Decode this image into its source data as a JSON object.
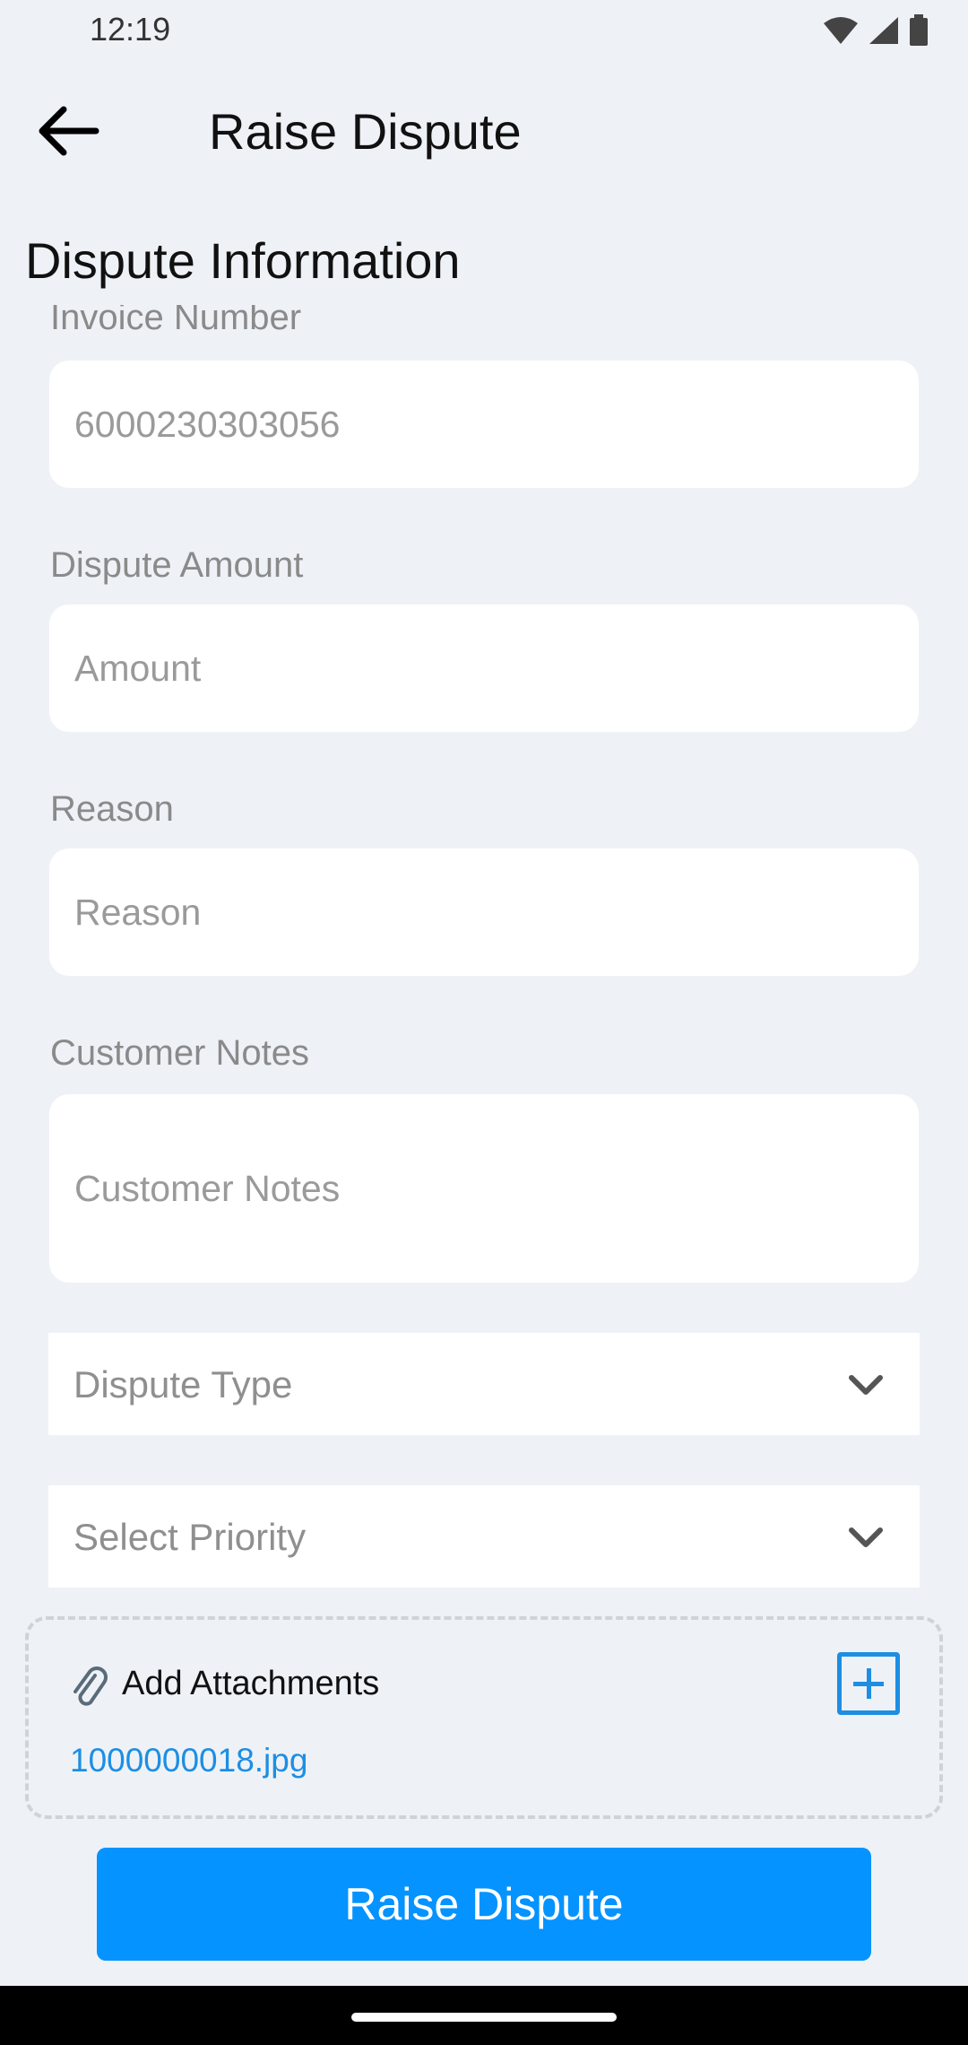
{
  "status_bar": {
    "time": "12:19"
  },
  "app_bar": {
    "title": "Raise Dispute"
  },
  "section": {
    "title": "Dispute Information"
  },
  "form": {
    "invoice": {
      "label": "Invoice Number",
      "value": "6000230303056"
    },
    "amount": {
      "label": "Dispute Amount",
      "placeholder": "Amount"
    },
    "reason": {
      "label": "Reason",
      "placeholder": "Reason"
    },
    "notes": {
      "label": "Customer Notes",
      "placeholder": "Customer Notes"
    },
    "dispute_type": {
      "placeholder": "Dispute Type"
    },
    "priority": {
      "placeholder": "Select Priority"
    }
  },
  "attachments": {
    "label": "Add Attachments",
    "file": "1000000018.jpg"
  },
  "submit": {
    "label": "Raise Dispute"
  },
  "colors": {
    "accent": "#0593ff",
    "link": "#1d8ee3",
    "background": "#eef2f7"
  }
}
